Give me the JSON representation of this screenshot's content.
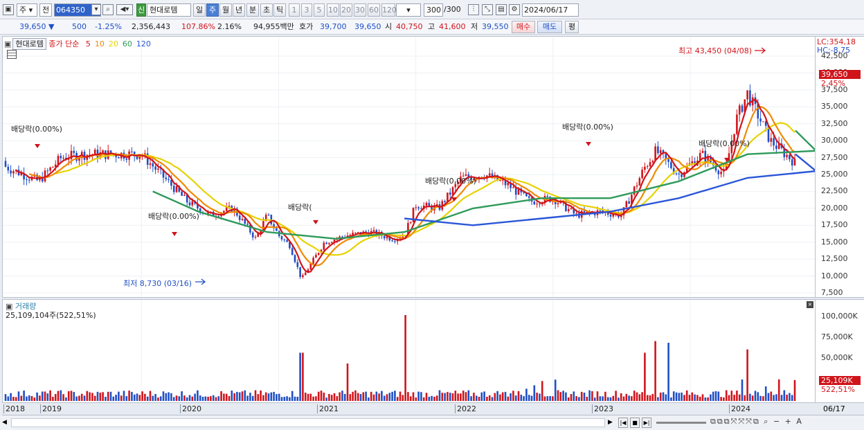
{
  "toolbar": {
    "period_type": "주",
    "prev": "전",
    "code": "064350",
    "badge": "신",
    "stock_name": "현대로템",
    "periods": [
      "일",
      "주",
      "월",
      "년",
      "분",
      "초",
      "틱"
    ],
    "selected_period": "주",
    "numbers": [
      "1",
      "3",
      "5",
      "10",
      "20",
      "30",
      "60",
      "120"
    ],
    "count": "300",
    "count_total": "/300",
    "date": "2024/06/17"
  },
  "info": {
    "price": "39,650",
    "change": "500",
    "change_pct": "-1.25%",
    "volume": "2,356,443",
    "vol_ratio": "107.86%",
    "turnover": "2.16%",
    "amount": "94,955백만",
    "ask_label": "호가",
    "ask": "39,700",
    "bid": "39,650",
    "open_label": "시",
    "open": "40,750",
    "high_label": "고",
    "high": "41,600",
    "low_label": "저",
    "low": "39,550",
    "buy_button": "매수",
    "sell_button": "매도",
    "eval_button": "평"
  },
  "legend": {
    "name": "현대로템",
    "ma_label": "종가 단순",
    "ma": [
      {
        "period": "5",
        "color": "#d0141b"
      },
      {
        "period": "10",
        "color": "#f08a00"
      },
      {
        "period": "20",
        "color": "#e6d200"
      },
      {
        "period": "60",
        "color": "#2e9a5a"
      },
      {
        "period": "120",
        "color": "#2a56d8"
      }
    ]
  },
  "volume_legend": {
    "title": "거래량",
    "value": "25,109,104주(522,51%)"
  },
  "annotations": {
    "high": "최고 43,450 (04/08)",
    "low": "최저 8,730 (03/16)",
    "dividend": "배당락(0.00%)",
    "dividend_partial": "배당락("
  },
  "price_axis": {
    "lc": "LC:354,18",
    "hc": "HC:-8,75",
    "current": "39,650",
    "current_pct": "2,45%",
    "ticks": [
      "42,500",
      "40,000",
      "37,500",
      "35,000",
      "32,500",
      "30,000",
      "27,500",
      "25,000",
      "22,500",
      "20,000",
      "17,500",
      "15,000",
      "12,500",
      "10,000",
      "7,500"
    ]
  },
  "volume_axis": {
    "ticks": [
      "100,000K",
      "75,000K",
      "50,000K"
    ],
    "current": "25,109K",
    "current_pct": "522,51%"
  },
  "date_axis": {
    "labels": [
      "2018",
      "2019",
      "2020",
      "2021",
      "2022",
      "2023",
      "2024"
    ],
    "last": "06/17"
  },
  "colors": {
    "up": "#d0141b",
    "down": "#1f4fc4",
    "ma5": "#d0141b",
    "ma10": "#f08a00",
    "ma20": "#e6d200",
    "ma60": "#2e9a5a",
    "ma120": "#2a56d8"
  },
  "chart_data": {
    "type": "candlestick",
    "interval": "weekly",
    "x_range": [
      "2017-12",
      "2024-06-17"
    ],
    "ylim": [
      7500,
      42500
    ],
    "close_path": [
      [
        "2017-12",
        27000
      ],
      [
        "2018-02",
        25500
      ],
      [
        "2018-04",
        24000
      ],
      [
        "2018-06",
        27500
      ],
      [
        "2018-08",
        28000
      ],
      [
        "2019-01",
        28000
      ],
      [
        "2019-03",
        24500
      ],
      [
        "2019-05",
        21000
      ],
      [
        "2019-07",
        19000
      ],
      [
        "2019-09",
        20000
      ],
      [
        "2019-11",
        15500
      ],
      [
        "2019-12",
        19000
      ],
      [
        "2020-01",
        16000
      ],
      [
        "2020-02",
        14500
      ],
      [
        "2020-03",
        9500
      ],
      [
        "2020-05",
        15000
      ],
      [
        "2020-07",
        16000
      ],
      [
        "2020-09",
        16500
      ],
      [
        "2020-11",
        15500
      ],
      [
        "2020-12",
        16000
      ],
      [
        "2021-01",
        20500
      ],
      [
        "2021-03",
        20000
      ],
      [
        "2021-05",
        24500
      ],
      [
        "2021-07",
        25000
      ],
      [
        "2021-09",
        23500
      ],
      [
        "2021-11",
        21000
      ],
      [
        "2022-01",
        21500
      ],
      [
        "2022-03",
        19000
      ],
      [
        "2022-05",
        19500
      ],
      [
        "2022-07",
        19000
      ],
      [
        "2022-09",
        26000
      ],
      [
        "2022-10",
        28500
      ],
      [
        "2022-12",
        25000
      ],
      [
        "2023-02",
        28000
      ],
      [
        "2023-04",
        25000
      ],
      [
        "2023-05",
        33000
      ],
      [
        "2023-06",
        37000
      ],
      [
        "2023-08",
        30000
      ],
      [
        "2023-10",
        27000
      ],
      [
        "2023-11",
        24500
      ],
      [
        "2024-01",
        27000
      ],
      [
        "2024-03",
        37000
      ],
      [
        "2024-04",
        41500
      ],
      [
        "2024-05",
        37000
      ],
      [
        "2024-06",
        39650
      ]
    ],
    "ma60_path": [
      [
        "2019-02",
        22500
      ],
      [
        "2019-06",
        19500
      ],
      [
        "2019-12",
        16500
      ],
      [
        "2020-06",
        15500
      ],
      [
        "2020-12",
        16500
      ],
      [
        "2021-06",
        20000
      ],
      [
        "2021-12",
        21500
      ],
      [
        "2022-06",
        21500
      ],
      [
        "2022-12",
        24000
      ],
      [
        "2023-06",
        28000
      ],
      [
        "2023-12",
        28500
      ],
      [
        "2024-06",
        31500
      ]
    ],
    "ma120_path": [
      [
        "2020-12",
        18500
      ],
      [
        "2021-06",
        17500
      ],
      [
        "2021-12",
        18500
      ],
      [
        "2022-06",
        19500
      ],
      [
        "2022-12",
        21500
      ],
      [
        "2023-06",
        24500
      ],
      [
        "2023-12",
        25500
      ],
      [
        "2024-06",
        28000
      ]
    ],
    "volume_spikes_k": [
      [
        "2020-03",
        58000
      ],
      [
        "2020-07",
        45000
      ],
      [
        "2020-12",
        112000
      ],
      [
        "2022-09",
        58000
      ],
      [
        "2022-10",
        72000
      ],
      [
        "2022-11",
        70000
      ],
      [
        "2023-06",
        62000
      ],
      [
        "2024-06",
        25109
      ]
    ],
    "high_marker": {
      "date": "04/08",
      "value": 43450
    },
    "low_marker": {
      "date": "03/16",
      "value": 8730
    }
  }
}
